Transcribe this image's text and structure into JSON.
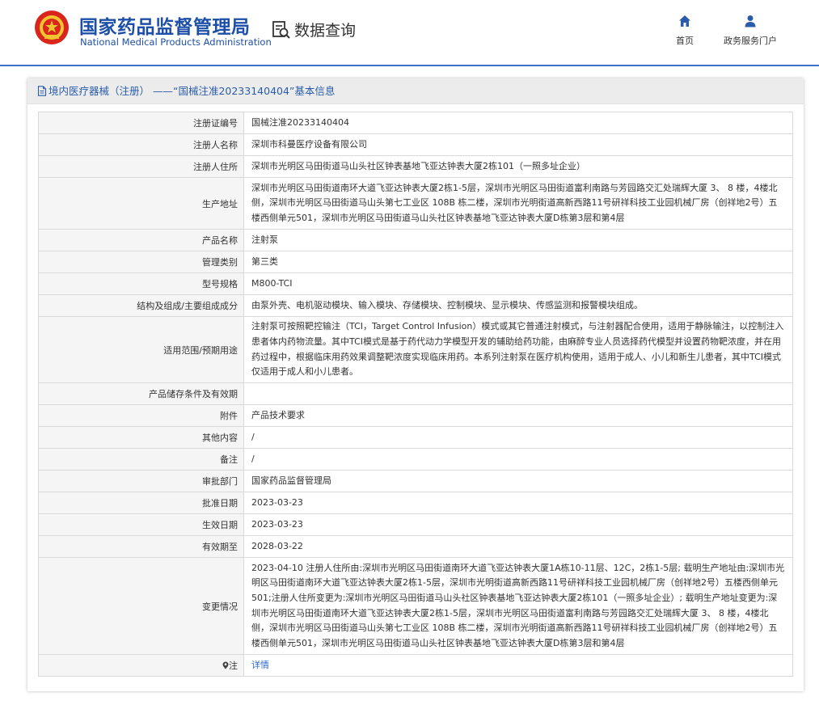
{
  "header": {
    "logo_cn": "国家药品监督管理局",
    "logo_en": "National Medical Products Administration",
    "query_label": "数据查询",
    "nav": {
      "home": "首页",
      "portal": "政务服务门户"
    }
  },
  "panel": {
    "title": "境内医疗器械（注册） ——“国械注准20233140404”基本信息"
  },
  "rows": [
    {
      "label": "注册证编号",
      "value": "国械注准20233140404"
    },
    {
      "label": "注册人名称",
      "value": "深圳市科曼医疗设备有限公司"
    },
    {
      "label": "注册人住所",
      "value": "深圳市光明区马田街道马山头社区钟表基地飞亚达钟表大厦2栋101（一照多址企业）"
    },
    {
      "label": "生产地址",
      "value": "深圳市光明区马田街道南环大道飞亚达钟表大厦2栋1-5层，深圳市光明区马田街道富利南路与芳园路交汇处瑞辉大厦 3、 8 楼，4楼北侧，深圳市光明区马田街道马山头第七工业区 108B 栋二楼，深圳市光明街道高新西路11号研祥科技工业园机械厂房（创祥地2号）五楼西侧单元501，深圳市光明区马田街道马山头社区钟表基地飞亚达钟表大厦D栋第3层和第4层"
    },
    {
      "label": "产品名称",
      "value": "注射泵"
    },
    {
      "label": "管理类别",
      "value": "第三类"
    },
    {
      "label": "型号规格",
      "value": "M800-TCI"
    },
    {
      "label": "结构及组成/主要组成成分",
      "value": "由泵外壳、电机驱动模块、输入模块、存储模块、控制模块、显示模块、传感监测和报警模块组成。"
    },
    {
      "label": "适用范围/预期用途",
      "value": "注射泵可按照靶控输注（TCI，Target Control Infusion）模式或其它普通注射模式，与注射器配合使用，适用于静脉输注，以控制注入患者体内药物流量。其中TCI模式是基于药代动力学模型开发的辅助给药功能，由麻醉专业人员选择药代模型并设置药物靶浓度，并在用药过程中，根据临床用药效果调整靶浓度实现临床用药。本系列注射泵在医疗机构使用，适用于成人、小儿和新生儿患者，其中TCI模式仅适用于成人和小儿患者。"
    },
    {
      "label": "产品储存条件及有效期",
      "value": ""
    },
    {
      "label": "附件",
      "value": "产品技术要求"
    },
    {
      "label": "其他内容",
      "value": "/"
    },
    {
      "label": "备注",
      "value": "/"
    },
    {
      "label": "审批部门",
      "value": "国家药品监督管理局"
    },
    {
      "label": "批准日期",
      "value": "2023-03-23"
    },
    {
      "label": "生效日期",
      "value": "2023-03-23"
    },
    {
      "label": "有效期至",
      "value": "2028-03-22"
    },
    {
      "label": "变更情况",
      "value": "2023-04-10 注册人住所由:深圳市光明区马田街道南环大道飞亚达钟表大厦1A栋10-11层、12C，2栋1-5层; 载明生产地址由:深圳市光明区马田街道南环大道飞亚达钟表大厦2栋1-5层，深圳市光明街道高新西路11号研祥科技工业园机械厂房（创祥地2号）五楼西侧单元501;注册人住所变更为:深圳市光明区马田街道马山头社区钟表基地飞亚达钟表大厦2栋101（一照多址企业）; 载明生产地址变更为:深圳市光明区马田街道南环大道飞亚达钟表大厦2栋1-5层，深圳市光明区马田街道富利南路与芳园路交汇处瑞辉大厦 3、 8 楼，4楼北侧，深圳市光明区马田街道马山头第七工业区 108B 栋二楼，深圳市光明街道高新西路11号研祥科技工业园机械厂房（创祥地2号）五楼西侧单元501，深圳市光明区马田街道马山头社区钟表基地飞亚达钟表大厦D栋第3层和第4层"
    },
    {
      "label": "注",
      "value": "详情"
    }
  ]
}
